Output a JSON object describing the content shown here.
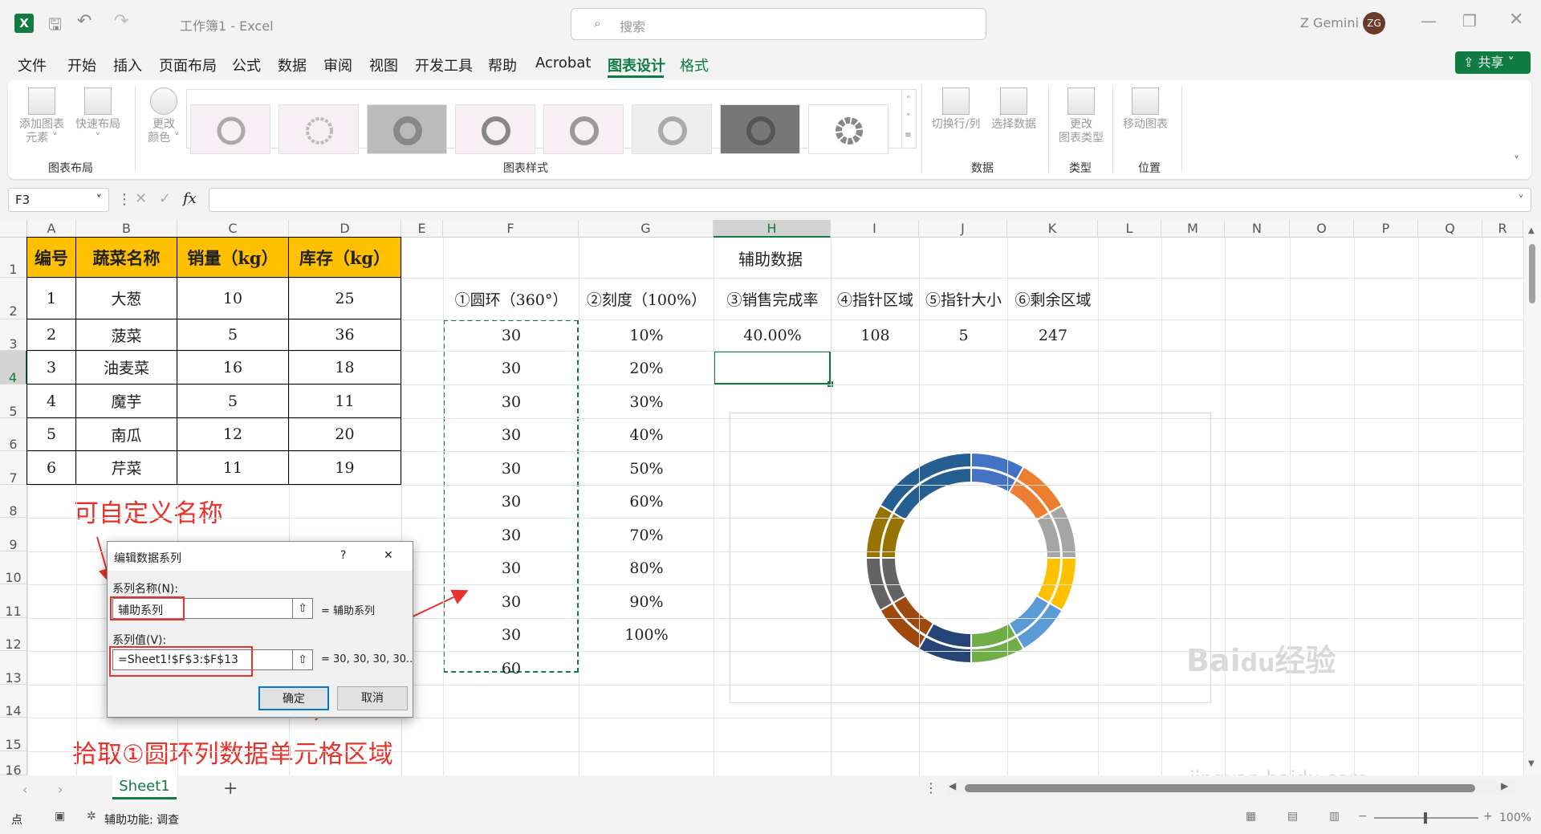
{
  "window": {
    "title": "工作簿1 - Excel",
    "search_placeholder": "搜索",
    "user": "Z Gemini",
    "avatar": "ZG"
  },
  "menu": {
    "items": [
      "文件",
      "开始",
      "插入",
      "页面布局",
      "公式",
      "数据",
      "审阅",
      "视图",
      "开发工具",
      "帮助",
      "Acrobat",
      "图表设计",
      "格式"
    ],
    "active": [
      "图表设计",
      "格式"
    ],
    "share": "共享"
  },
  "ribbon": {
    "add_element": "添加图表\n元素 ˅",
    "quick_layout": "快速布局\n˅",
    "change_color": "更改\n颜色 ˅",
    "switch_row_col": "切换行/列",
    "select_data": "选择数据",
    "change_type": "更改\n图表类型",
    "move_chart": "移动图表",
    "groups": {
      "layout": "图表布局",
      "styles": "图表样式",
      "data": "数据",
      "type": "类型",
      "location": "位置"
    }
  },
  "formula_bar": {
    "cell": "F3",
    "formula": ""
  },
  "columns": [
    "A",
    "B",
    "C",
    "D",
    "E",
    "F",
    "G",
    "H",
    "I",
    "J",
    "K",
    "L",
    "M",
    "N",
    "O",
    "P",
    "Q",
    "R"
  ],
  "rows": [
    "1",
    "2",
    "3",
    "4",
    "5",
    "6",
    "7",
    "8",
    "9",
    "10",
    "11",
    "12",
    "13",
    "14",
    "15",
    "16"
  ],
  "table": {
    "headers": [
      "编号",
      "蔬菜名称",
      "销量（kg）",
      "库存（kg）"
    ],
    "rows": [
      [
        "1",
        "大葱",
        "10",
        "25"
      ],
      [
        "2",
        "菠菜",
        "5",
        "36"
      ],
      [
        "3",
        "油麦菜",
        "16",
        "18"
      ],
      [
        "4",
        "魔芋",
        "5",
        "11"
      ],
      [
        "5",
        "南瓜",
        "12",
        "20"
      ],
      [
        "6",
        "芹菜",
        "11",
        "19"
      ]
    ]
  },
  "aux": {
    "title": "辅助数据",
    "headers": [
      "①圆环（360°）",
      "②刻度（100%）",
      "③销售完成率",
      "④指针区域",
      "⑤指针大小",
      "⑥剩余区域"
    ],
    "ring": [
      "30",
      "30",
      "30",
      "30",
      "30",
      "30",
      "30",
      "30",
      "30",
      "30",
      "60"
    ],
    "scale": [
      "10%",
      "20%",
      "30%",
      "40%",
      "50%",
      "60%",
      "70%",
      "80%",
      "90%",
      "100%"
    ],
    "row3": [
      "40.00%",
      "108",
      "5",
      "247"
    ]
  },
  "annotations": {
    "top": "可自定义名称",
    "bottom": "拾取①圆环列数据单元格区域"
  },
  "dialog": {
    "title": "编辑数据系列",
    "help": "?",
    "close": "✕",
    "name_label": "系列名称(N):",
    "name_value": "辅助系列",
    "name_preview": "= 辅助系列",
    "values_label": "系列值(V):",
    "values_value": "=Sheet1!$F$3:$F$13",
    "values_preview": "= 30, 30, 30, 30...",
    "ok": "确定",
    "cancel": "取消"
  },
  "sheet_tab": "Sheet1",
  "status": {
    "mode": "点",
    "accessibility": "辅助功能: 调查",
    "zoom": "100%"
  },
  "watermark": "jingyan.baidu.com",
  "chart_data": {
    "type": "pie",
    "subtype": "doughnut",
    "series": [
      {
        "name": "",
        "values": [
          30,
          30,
          30,
          30,
          30,
          30,
          30,
          30,
          30,
          30,
          60
        ]
      },
      {
        "name": "",
        "values": [
          30,
          30,
          30,
          30,
          30,
          30,
          30,
          30,
          30,
          30,
          60
        ]
      }
    ],
    "colors": [
      "#4472c4",
      "#ed7d31",
      "#a5a5a5",
      "#ffc000",
      "#5b9bd5",
      "#70ad47",
      "#264478",
      "#9e480e",
      "#636363",
      "#997300",
      "#255e91"
    ]
  }
}
